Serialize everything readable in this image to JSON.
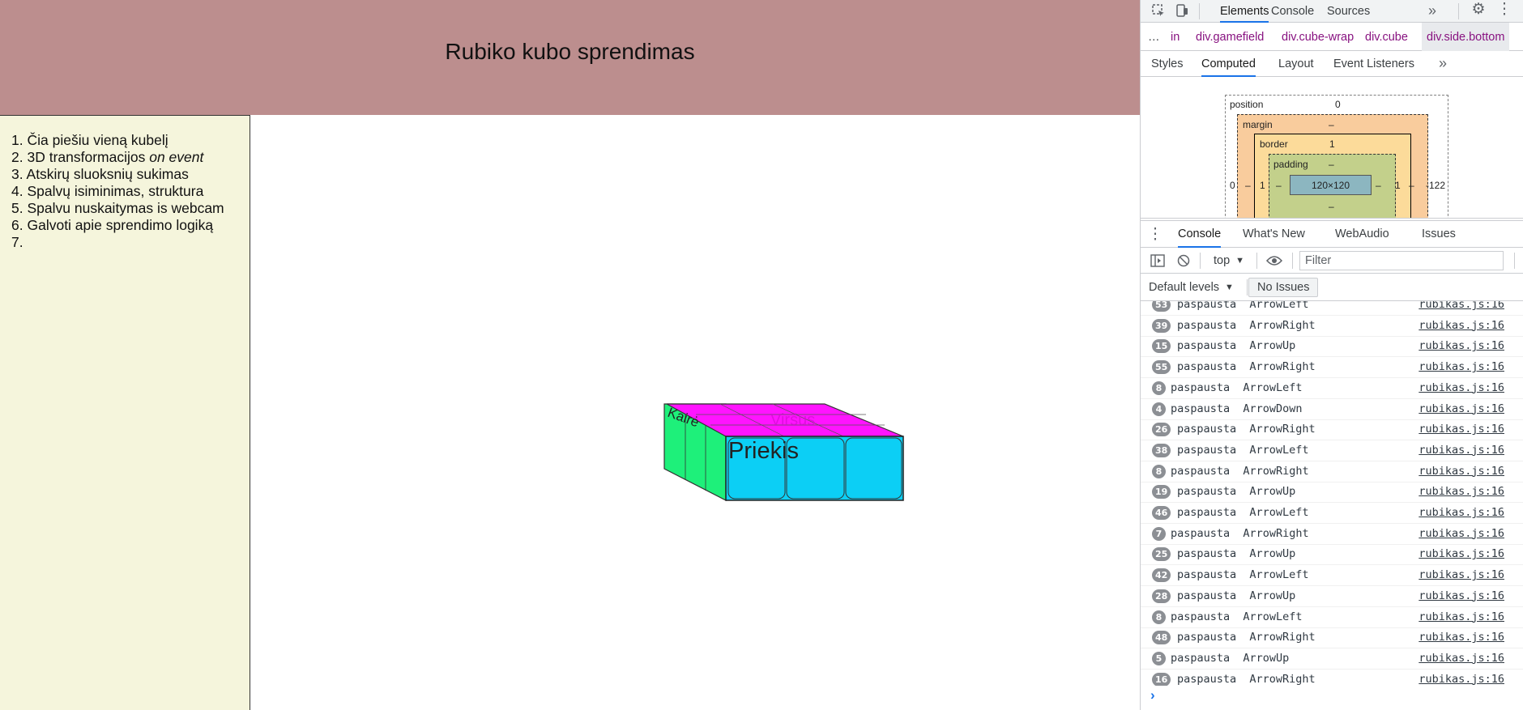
{
  "page": {
    "title": "Rubiko kubo sprendimas",
    "todo": [
      {
        "num": "1.",
        "text": "Čia piešiu vieną kubelį",
        "em": ""
      },
      {
        "num": "2.",
        "text": "3D transformacijos ",
        "em": "on event"
      },
      {
        "num": "3.",
        "text": "Atskirų sluoksnių sukimas",
        "em": ""
      },
      {
        "num": "4.",
        "text": "Spalvų isiminimas, struktura",
        "em": ""
      },
      {
        "num": "5.",
        "text": "Spalvu nuskaitymas is webcam",
        "em": ""
      },
      {
        "num": "6.",
        "text": "Galvoti apie sprendimo logiką",
        "em": ""
      },
      {
        "num": "7.",
        "text": "",
        "em": ""
      }
    ],
    "cube": {
      "front_label": "Priekis",
      "left_label": "Kairė",
      "top_label": "Viršus",
      "colors": {
        "front": "#0ccff5",
        "left": "#1ef07a",
        "top": "#ff14ff"
      }
    }
  },
  "devtools": {
    "top_tabs": [
      "Elements",
      "Console",
      "Sources"
    ],
    "active_top_tab": "Elements",
    "more_tabs_glyph": "»",
    "breadcrumbs": [
      "…",
      "in",
      "div.gamefield",
      "div.cube-wrap",
      "div.cube",
      "div.side.bottom"
    ],
    "sub_tabs": [
      "Styles",
      "Computed",
      "Layout",
      "Event Listeners"
    ],
    "active_sub_tab": "Computed",
    "box_model": {
      "position_label": "position",
      "position_value": "0",
      "margin_label": "margin",
      "margin_value": "–",
      "border_label": "border",
      "border_value": "1",
      "padding_label": "padding",
      "padding_value": "–",
      "content": "120×120",
      "left_outer": "0",
      "right_outer": "-122",
      "margin_left": "–",
      "border_left": "1",
      "padding_left": "–",
      "padding_right": "–",
      "border_right": "1",
      "margin_right": "–",
      "padding_bottom": "–"
    },
    "drawer_tabs": [
      "Console",
      "What's New",
      "WebAudio",
      "Issues"
    ],
    "active_drawer_tab": "Console",
    "context": "top",
    "filter_placeholder": "Filter",
    "levels": "Default levels",
    "issues": "No Issues",
    "prompt": "›",
    "logs": [
      {
        "count": "53",
        "msg": "paspausta  ArrowLeft",
        "src": "rubikas.js:16"
      },
      {
        "count": "39",
        "msg": "paspausta  ArrowRight",
        "src": "rubikas.js:16"
      },
      {
        "count": "15",
        "msg": "paspausta  ArrowUp",
        "src": "rubikas.js:16"
      },
      {
        "count": "55",
        "msg": "paspausta  ArrowRight",
        "src": "rubikas.js:16"
      },
      {
        "count": "8",
        "msg": "paspausta  ArrowLeft",
        "src": "rubikas.js:16"
      },
      {
        "count": "4",
        "msg": "paspausta  ArrowDown",
        "src": "rubikas.js:16"
      },
      {
        "count": "26",
        "msg": "paspausta  ArrowRight",
        "src": "rubikas.js:16"
      },
      {
        "count": "38",
        "msg": "paspausta  ArrowLeft",
        "src": "rubikas.js:16"
      },
      {
        "count": "8",
        "msg": "paspausta  ArrowRight",
        "src": "rubikas.js:16"
      },
      {
        "count": "19",
        "msg": "paspausta  ArrowUp",
        "src": "rubikas.js:16"
      },
      {
        "count": "46",
        "msg": "paspausta  ArrowLeft",
        "src": "rubikas.js:16"
      },
      {
        "count": "7",
        "msg": "paspausta  ArrowRight",
        "src": "rubikas.js:16"
      },
      {
        "count": "25",
        "msg": "paspausta  ArrowUp",
        "src": "rubikas.js:16"
      },
      {
        "count": "42",
        "msg": "paspausta  ArrowLeft",
        "src": "rubikas.js:16"
      },
      {
        "count": "28",
        "msg": "paspausta  ArrowUp",
        "src": "rubikas.js:16"
      },
      {
        "count": "8",
        "msg": "paspausta  ArrowLeft",
        "src": "rubikas.js:16"
      },
      {
        "count": "48",
        "msg": "paspausta  ArrowRight",
        "src": "rubikas.js:16"
      },
      {
        "count": "5",
        "msg": "paspausta  ArrowUp",
        "src": "rubikas.js:16"
      },
      {
        "count": "16",
        "msg": "paspausta  ArrowRight",
        "src": "rubikas.js:16"
      }
    ]
  }
}
